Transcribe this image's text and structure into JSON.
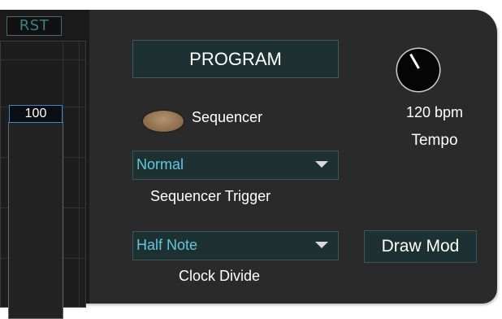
{
  "sequencer": {
    "reset_label": "RST",
    "step_value": "100"
  },
  "program": {
    "button_label": "PROGRAM"
  },
  "sequencer_toggle": {
    "label": "Sequencer",
    "led_color": "#9a7a57"
  },
  "sequencer_trigger": {
    "value": "Normal",
    "label": "Sequencer Trigger"
  },
  "clock_divide": {
    "value": "Half Note",
    "label": "Clock Divide"
  },
  "tempo": {
    "value_label": "120 bpm",
    "label": "Tempo",
    "knob_icon": "knob"
  },
  "draw_mod": {
    "button_label": "Draw Mod"
  },
  "colors": {
    "panel": "#2a2a2a",
    "button_bg": "#1e3132",
    "select_text": "#63c6dd",
    "value_border": "#3f86c9"
  }
}
